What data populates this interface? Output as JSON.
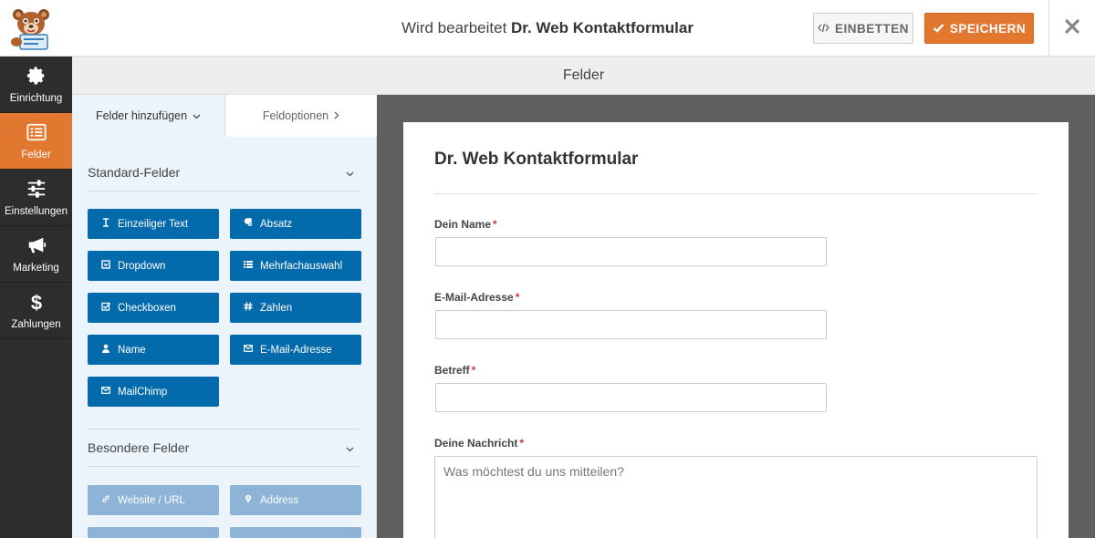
{
  "topbar": {
    "title_prefix": "Wird bearbeitet",
    "form_name": "Dr. Web Kontaktformular",
    "embed_label": "EINBETTEN",
    "save_label": "SPEICHERN"
  },
  "sidebar": {
    "items": [
      {
        "label": "Einrichtung",
        "icon": "gear-icon",
        "active": false
      },
      {
        "label": "Felder",
        "icon": "fields-list-icon",
        "active": true
      },
      {
        "label": "Einstellungen",
        "icon": "sliders-icon",
        "active": false
      },
      {
        "label": "Marketing",
        "icon": "megaphone-icon",
        "active": false
      },
      {
        "label": "Zahlungen",
        "icon": "dollar-icon",
        "active": false
      }
    ]
  },
  "header": {
    "title": "Felder"
  },
  "panel": {
    "tabs": [
      {
        "label": "Felder hinzufügen",
        "icon": "chevron-down-icon"
      },
      {
        "label": "Feldoptionen",
        "icon": "chevron-right-icon"
      }
    ],
    "standard_section": "Standard-Felder",
    "standard_fields": [
      {
        "label": "Einzeiliger Text",
        "icon": "text-cursor-icon"
      },
      {
        "label": "Absatz",
        "icon": "paragraph-icon"
      },
      {
        "label": "Dropdown",
        "icon": "dropdown-icon"
      },
      {
        "label": "Mehrfachauswahl",
        "icon": "list-icon"
      },
      {
        "label": "Checkboxen",
        "icon": "checkbox-icon"
      },
      {
        "label": "Zahlen",
        "icon": "hash-icon"
      },
      {
        "label": "Name",
        "icon": "user-icon"
      },
      {
        "label": "E-Mail-Adresse",
        "icon": "envelope-icon"
      },
      {
        "label": "MailChimp",
        "icon": "envelope-icon"
      }
    ],
    "special_section": "Besondere Felder",
    "special_fields": [
      {
        "label": "Website / URL",
        "icon": "link-icon"
      },
      {
        "label": "Address",
        "icon": "map-pin-icon"
      }
    ]
  },
  "form": {
    "title": "Dr. Web Kontaktformular",
    "required_marker": "*",
    "fields": [
      {
        "label": "Dein Name"
      },
      {
        "label": "E-Mail-Adresse"
      },
      {
        "label": "Betreff"
      },
      {
        "label": "Deine Nachricht",
        "placeholder": "Was möchtest du uns mitteilen?"
      }
    ]
  },
  "colors": {
    "accent": "#e27730",
    "sidebar": "#2d2d2d",
    "field_button": "#036aab",
    "field_button_disabled": "#8db4d6",
    "preview_bg": "#5f5f5f",
    "panel_bg": "#ebf3fb"
  }
}
